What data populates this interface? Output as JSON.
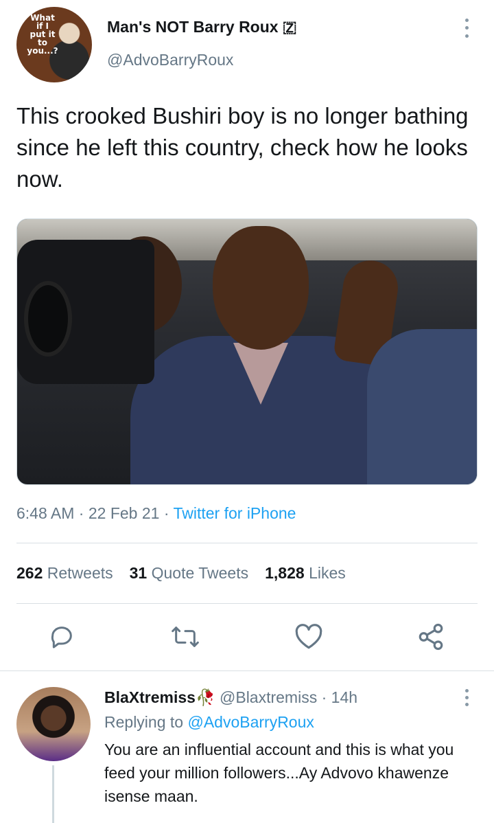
{
  "tweet": {
    "author": {
      "display_name": "Man's NOT Barry Roux 🇿",
      "handle": "@AdvoBarryRoux",
      "avatar_caption": "What if I put it to you...?"
    },
    "text": "This crooked Bushiri boy is no longer bathing since he left this country, check how he looks now.",
    "time": "6:48 AM",
    "date": "22 Feb 21",
    "source": "Twitter for iPhone",
    "separator": " · ",
    "stats": {
      "retweets_count": "262",
      "retweets_label": "Retweets",
      "quote_count": "31",
      "quote_label": "Quote Tweets",
      "likes_count": "1,828",
      "likes_label": "Likes"
    }
  },
  "icons": {
    "more": "more-vertical-icon",
    "reply": "reply-icon",
    "retweet": "retweet-icon",
    "like": "heart-icon",
    "share": "share-icon"
  },
  "reply": {
    "display_name": "BlaXtremiss🥀",
    "handle": "@Blaxtremiss",
    "age": "14h",
    "replying_to_label": "Replying to ",
    "replying_to_handle": "@AdvoBarryRoux",
    "text": "You are an influential account and this is what you feed your million followers...Ay Advovo khawenze isense maan."
  },
  "colors": {
    "accent": "#1da1f2",
    "text": "#14171a",
    "secondary": "#657786",
    "divider": "#d9dfe3"
  }
}
